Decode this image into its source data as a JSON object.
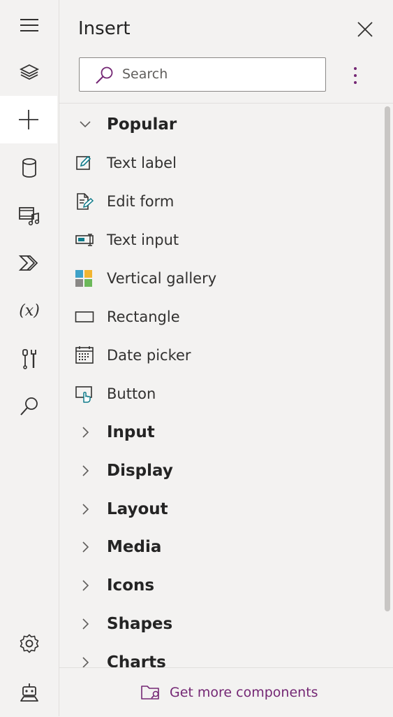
{
  "panel": {
    "title": "Insert",
    "search_placeholder": "Search",
    "footer_label": "Get more components"
  },
  "rail": {
    "items": [
      {
        "name": "hamburger-icon"
      },
      {
        "name": "layers-icon"
      },
      {
        "name": "add-icon",
        "active": true
      },
      {
        "name": "database-icon"
      },
      {
        "name": "media-icon"
      },
      {
        "name": "power-automate-icon"
      },
      {
        "name": "variables-icon",
        "text": "(x)"
      },
      {
        "name": "tools-icon"
      },
      {
        "name": "search-icon"
      }
    ],
    "bottom": [
      {
        "name": "settings-icon"
      },
      {
        "name": "copilot-bot-icon"
      }
    ]
  },
  "popular": {
    "label": "Popular",
    "items": [
      {
        "label": "Text label",
        "icon": "text-label-icon"
      },
      {
        "label": "Edit form",
        "icon": "edit-form-icon"
      },
      {
        "label": "Text input",
        "icon": "text-input-icon"
      },
      {
        "label": "Vertical gallery",
        "icon": "vertical-gallery-icon"
      },
      {
        "label": "Rectangle",
        "icon": "rectangle-icon"
      },
      {
        "label": "Date picker",
        "icon": "date-picker-icon"
      },
      {
        "label": "Button",
        "icon": "button-icon"
      }
    ]
  },
  "categories": [
    {
      "label": "Input"
    },
    {
      "label": "Display"
    },
    {
      "label": "Layout"
    },
    {
      "label": "Media"
    },
    {
      "label": "Icons"
    },
    {
      "label": "Shapes"
    },
    {
      "label": "Charts"
    }
  ],
  "colors": {
    "accent": "#742774",
    "background": "#f3f2f1"
  }
}
